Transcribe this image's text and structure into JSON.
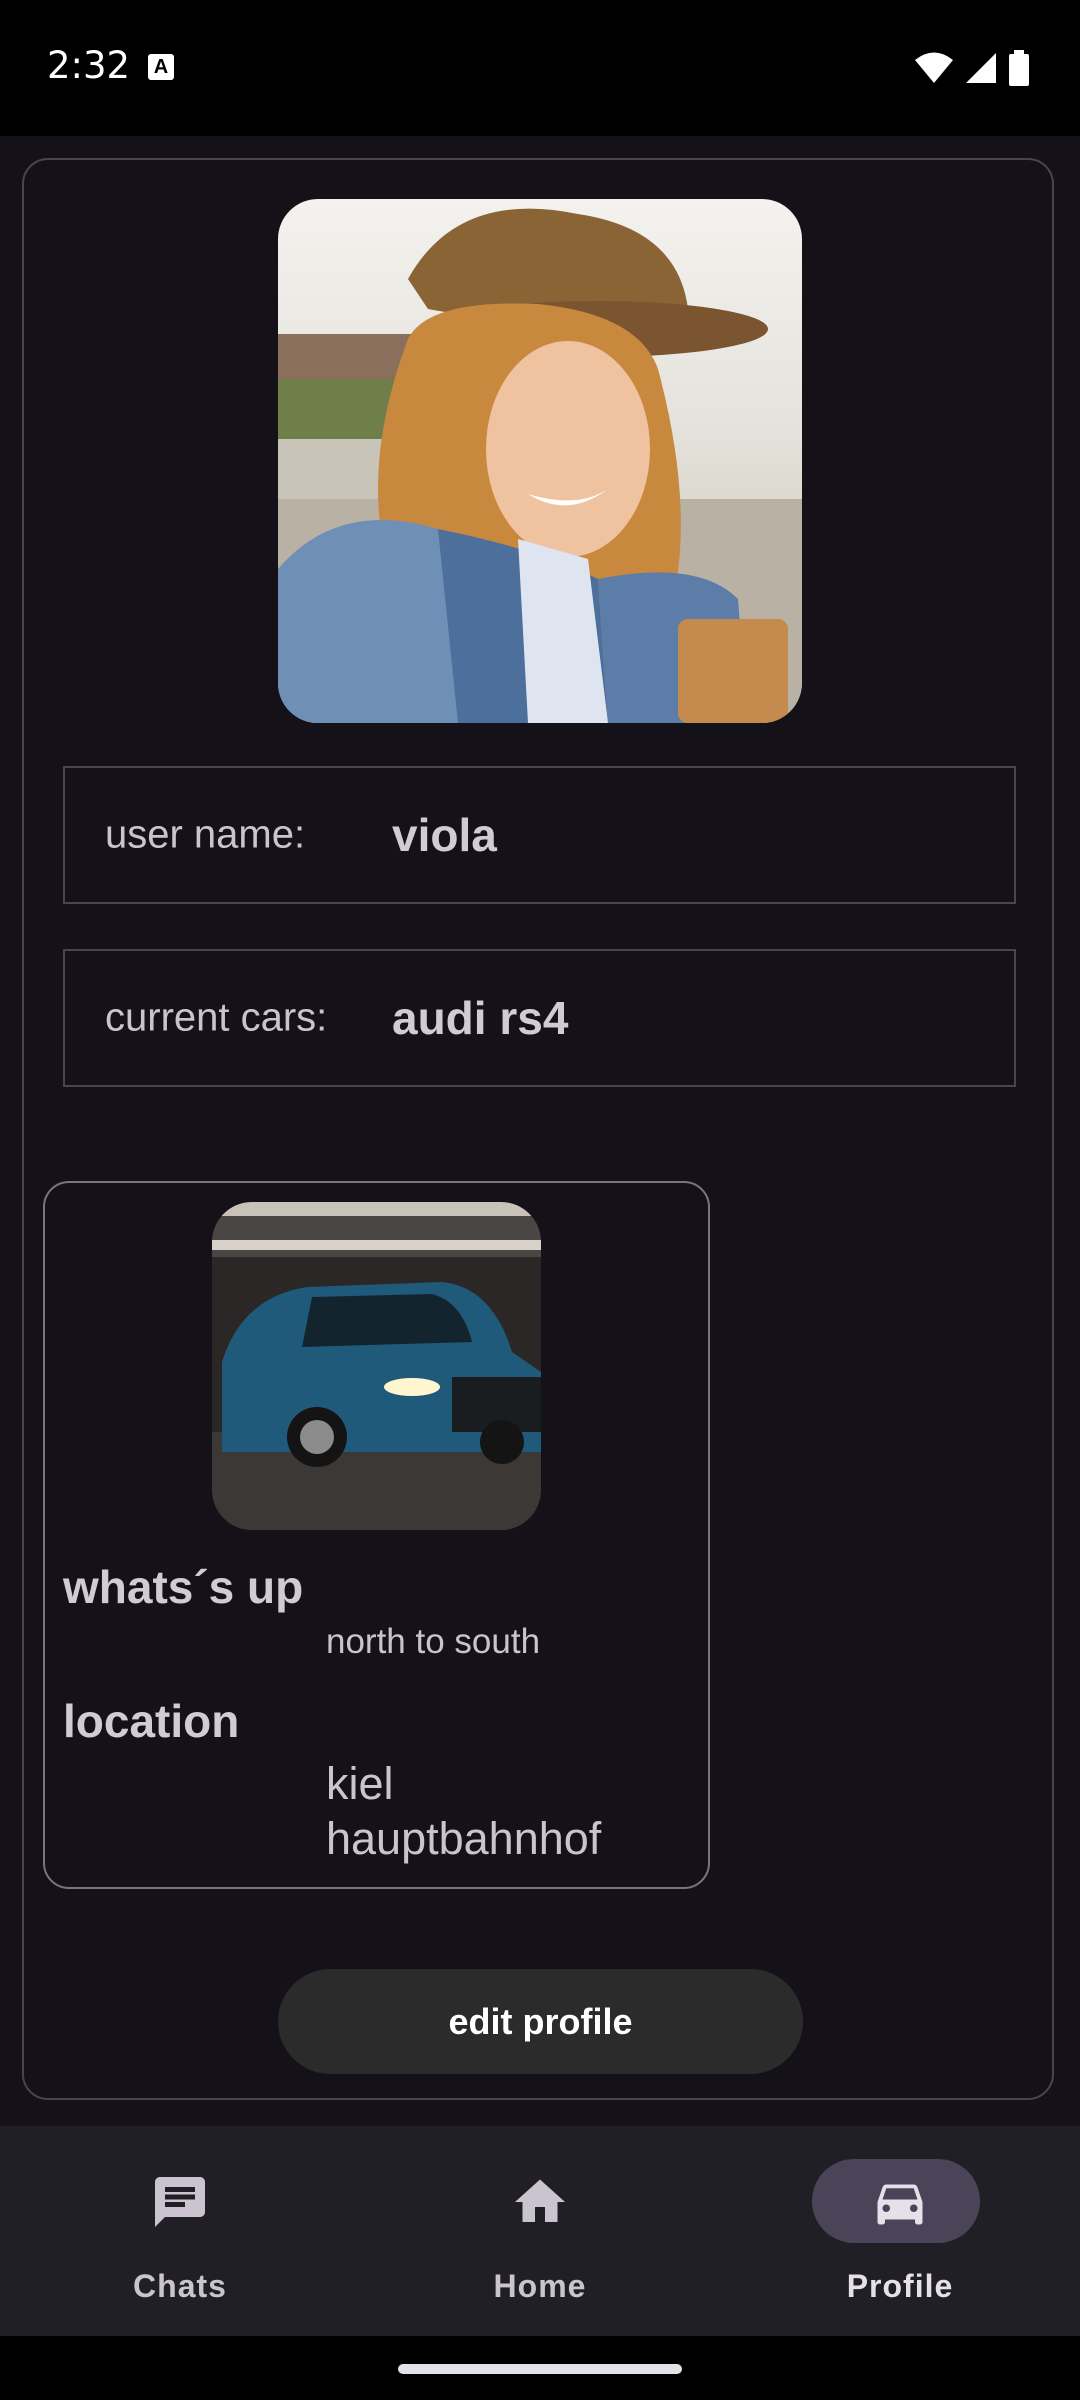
{
  "status_bar": {
    "time": "2:32",
    "notification_icon": "a-badge-icon",
    "icons": [
      "wifi-icon",
      "signal-icon",
      "battery-icon"
    ]
  },
  "profile": {
    "avatar_alt": "profile photo",
    "user_name_label": "user name:",
    "user_name_value": "viola",
    "cars_label": "current cars:",
    "cars_value": "audi rs4"
  },
  "car_card": {
    "image_alt": "car photo",
    "whats_up_heading": "whats´s up",
    "whats_up_value": "north to south",
    "location_heading": "location",
    "location_value_line1": "kiel",
    "location_value_line2": "hauptbahnhof"
  },
  "edit_button_label": "edit profile",
  "nav": {
    "items": [
      {
        "label": "Chats",
        "icon": "chat-icon",
        "active": false
      },
      {
        "label": "Home",
        "icon": "home-icon",
        "active": false
      },
      {
        "label": "Profile",
        "icon": "car-icon",
        "active": true
      }
    ]
  },
  "colors": {
    "background": "#141218",
    "nav_background": "#211f26",
    "active_pill": "#4a4458",
    "button": "#2b2b2b",
    "border": "#49454f"
  }
}
